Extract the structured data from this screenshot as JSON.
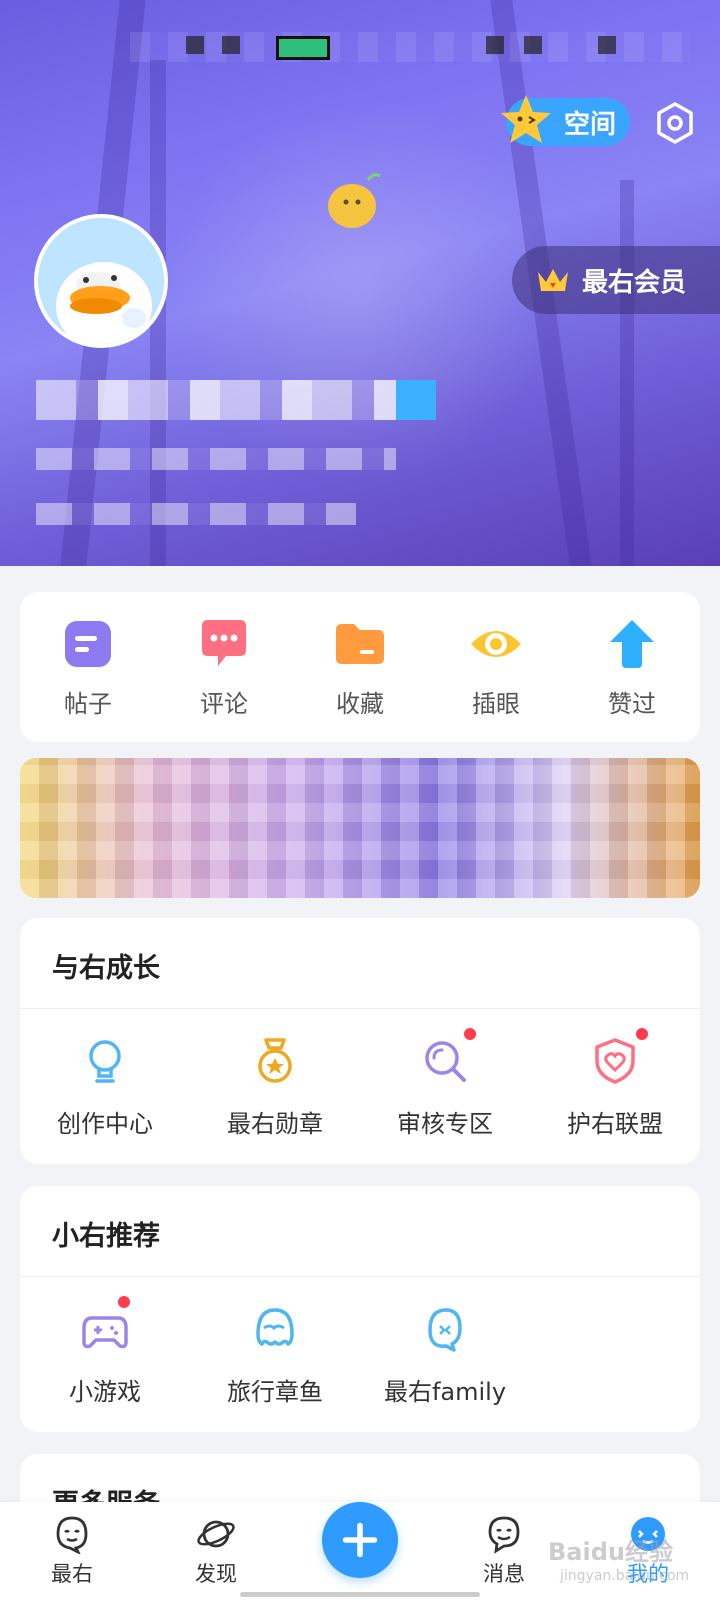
{
  "header": {
    "space_label": "空间",
    "vip_label": "最右会员"
  },
  "quick_actions": [
    {
      "label": "帖子",
      "icon": "post-icon",
      "color": "#8d79f0"
    },
    {
      "label": "评论",
      "icon": "comment-icon",
      "color": "#ff6f82"
    },
    {
      "label": "收藏",
      "icon": "folder-icon",
      "color": "#ff9a3d"
    },
    {
      "label": "插眼",
      "icon": "eye-icon",
      "color": "#ffc530"
    },
    {
      "label": "赞过",
      "icon": "upvote-icon",
      "color": "#2fb0ff"
    }
  ],
  "growth": {
    "title": "与右成长",
    "items": [
      {
        "label": "创作中心",
        "icon": "lightbulb-icon",
        "badge": false
      },
      {
        "label": "最右勋章",
        "icon": "medal-icon",
        "badge": false
      },
      {
        "label": "审核专区",
        "icon": "magnifier-icon",
        "badge": true
      },
      {
        "label": "护右联盟",
        "icon": "shield-heart-icon",
        "badge": true
      }
    ]
  },
  "recommend": {
    "title": "小右推荐",
    "items": [
      {
        "label": "小游戏",
        "icon": "gamepad-icon",
        "badge": true
      },
      {
        "label": "旅行章鱼",
        "icon": "octopus-icon",
        "badge": false
      },
      {
        "label": "最右family",
        "icon": "family-mascot-icon",
        "badge": false
      }
    ]
  },
  "more_services": {
    "title": "更多服务"
  },
  "tabbar": {
    "items": [
      {
        "label": "最右",
        "active": false
      },
      {
        "label": "发现",
        "active": false
      },
      {
        "label": "消息",
        "active": false
      },
      {
        "label": "我的",
        "active": true
      }
    ]
  },
  "watermark": {
    "text": "Baidu经验",
    "url_text": "jingyan.baidu.com"
  },
  "colors": {
    "accent": "#2f9bff",
    "red_dot": "#ff3b4e"
  }
}
